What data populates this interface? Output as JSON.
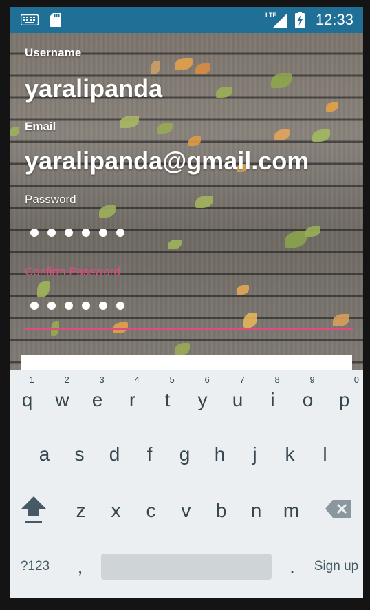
{
  "status_bar": {
    "time": "12:33",
    "network": "LTE",
    "icons": [
      "keyboard-icon",
      "sd-card-icon",
      "signal-icon",
      "battery-charging-icon"
    ]
  },
  "form": {
    "username_label": "Username",
    "username_value": "yaralipanda",
    "email_label": "Email",
    "email_value": "yaralipanda@gmail.com",
    "password_label": "Password",
    "password_dots": 6,
    "confirm_label": "Confirm Password",
    "confirm_dots": 6,
    "accent_color": "#e14b80"
  },
  "keyboard": {
    "row1": [
      {
        "key": "q",
        "hint": "1"
      },
      {
        "key": "w",
        "hint": "2"
      },
      {
        "key": "e",
        "hint": "3"
      },
      {
        "key": "r",
        "hint": "4"
      },
      {
        "key": "t",
        "hint": "5"
      },
      {
        "key": "y",
        "hint": "6"
      },
      {
        "key": "u",
        "hint": "7"
      },
      {
        "key": "i",
        "hint": "8"
      },
      {
        "key": "o",
        "hint": "9"
      },
      {
        "key": "p",
        "hint": "0"
      }
    ],
    "row2": [
      "a",
      "s",
      "d",
      "f",
      "g",
      "h",
      "j",
      "k",
      "l"
    ],
    "row3": [
      "z",
      "x",
      "c",
      "v",
      "b",
      "n",
      "m"
    ],
    "symbols_label": "?123",
    "comma": ",",
    "period": ".",
    "action_label": "Sign up"
  },
  "colors": {
    "status_bar": "#1f6f96",
    "keyboard_bg": "#eceff1",
    "key_text": "#37474f"
  }
}
